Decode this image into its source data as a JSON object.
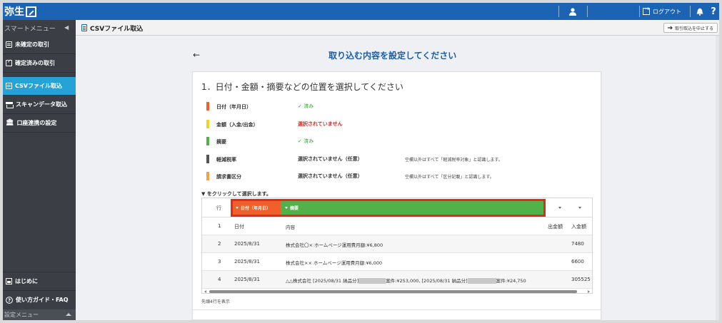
{
  "app": {
    "logo_text": "弥生",
    "logout_label": "ログアウト",
    "help_label": "?"
  },
  "header": {
    "smart_menu_label": "スマートメニュー",
    "smart_menu_toggle": "◀",
    "breadcrumb_title": "CSVファイル取込",
    "abort_label": "取引取込を中止する"
  },
  "sidebar": {
    "items": [
      {
        "label": "未確定の取引",
        "icon": "list-icon"
      },
      {
        "label": "確定済みの取引",
        "icon": "check-list-icon"
      },
      {
        "label": "CSVファイル取込",
        "icon": "csv-file-icon",
        "active": true
      },
      {
        "label": "スキャンデータ取込",
        "icon": "scanner-icon"
      },
      {
        "label": "口座連携の設定",
        "icon": "bank-icon"
      }
    ],
    "bottom_items": [
      {
        "label": "はじめに",
        "icon": "guide-icon"
      },
      {
        "label": "使い方ガイド・FAQ",
        "icon": "help-circle-icon"
      }
    ],
    "settings_menu_label": "設定メニュー"
  },
  "main": {
    "back_arrow": "←",
    "page_title": "取り込む内容を設定してください",
    "card_title": "1．日付・金額・摘要などの位置を選択してください",
    "fields": [
      {
        "label": "日付（年月日）",
        "status": "✓ 済み",
        "status_type": "done",
        "note": "",
        "color": "#f0602a"
      },
      {
        "label": "金額（入金/出金）",
        "status": "選択されていません",
        "status_type": "missing",
        "note": "",
        "color": "#f5d31c"
      },
      {
        "label": "摘要",
        "status": "✓ 済み",
        "status_type": "done",
        "note": "",
        "color": "#52b24a"
      },
      {
        "label": "軽減税率",
        "status": "選択されていません（任意）",
        "status_type": "optional",
        "note": "空欄以外はすべて「軽減税率対象」と認識します。",
        "color": "#555555"
      },
      {
        "label": "請求書区分",
        "status": "選択されていません（任意）",
        "status_type": "optional",
        "note": "空欄以外はすべて「区分記載」と認識します。",
        "color": "#f2a24a"
      }
    ],
    "instruction": "▼ をクリックして選択します。",
    "grid": {
      "row_header": "行",
      "selected_columns": {
        "date_label": "日付（年月日）",
        "summary_label": "摘要"
      },
      "rows": [
        {
          "num": "1",
          "date": "日付",
          "desc_parts": [
            "内容"
          ],
          "out": "出金額",
          "in": "入金額"
        },
        {
          "num": "2",
          "date": "2025/8/31",
          "desc_parts": [
            "株式会社〇× ホームページ運用費月額:¥6,800"
          ],
          "out": "",
          "in": "7480"
        },
        {
          "num": "3",
          "date": "2025/8/31",
          "desc_parts": [
            "株式会社×× ホームページ運用費月額:¥6,000"
          ],
          "out": "",
          "in": "6600"
        },
        {
          "num": "4",
          "date": "2025/8/31",
          "desc_parts": [
            "△△株式会社 [2025/08/31 納品分]",
            "案件:¥253,000, [2025/08/31 納品分]",
            "案件:¥24,750"
          ],
          "out": "",
          "in": "305525"
        }
      ]
    },
    "showing_label": "先頭4行を表示"
  },
  "colors": {
    "topbar": "#1b63b3",
    "sidebar": "#3b3f45",
    "active_item": "#25a3d6",
    "title_blue": "#1b5ea8",
    "done_green": "#29a329",
    "missing_red": "#d9261c",
    "highlight_border": "#e02a1b"
  }
}
